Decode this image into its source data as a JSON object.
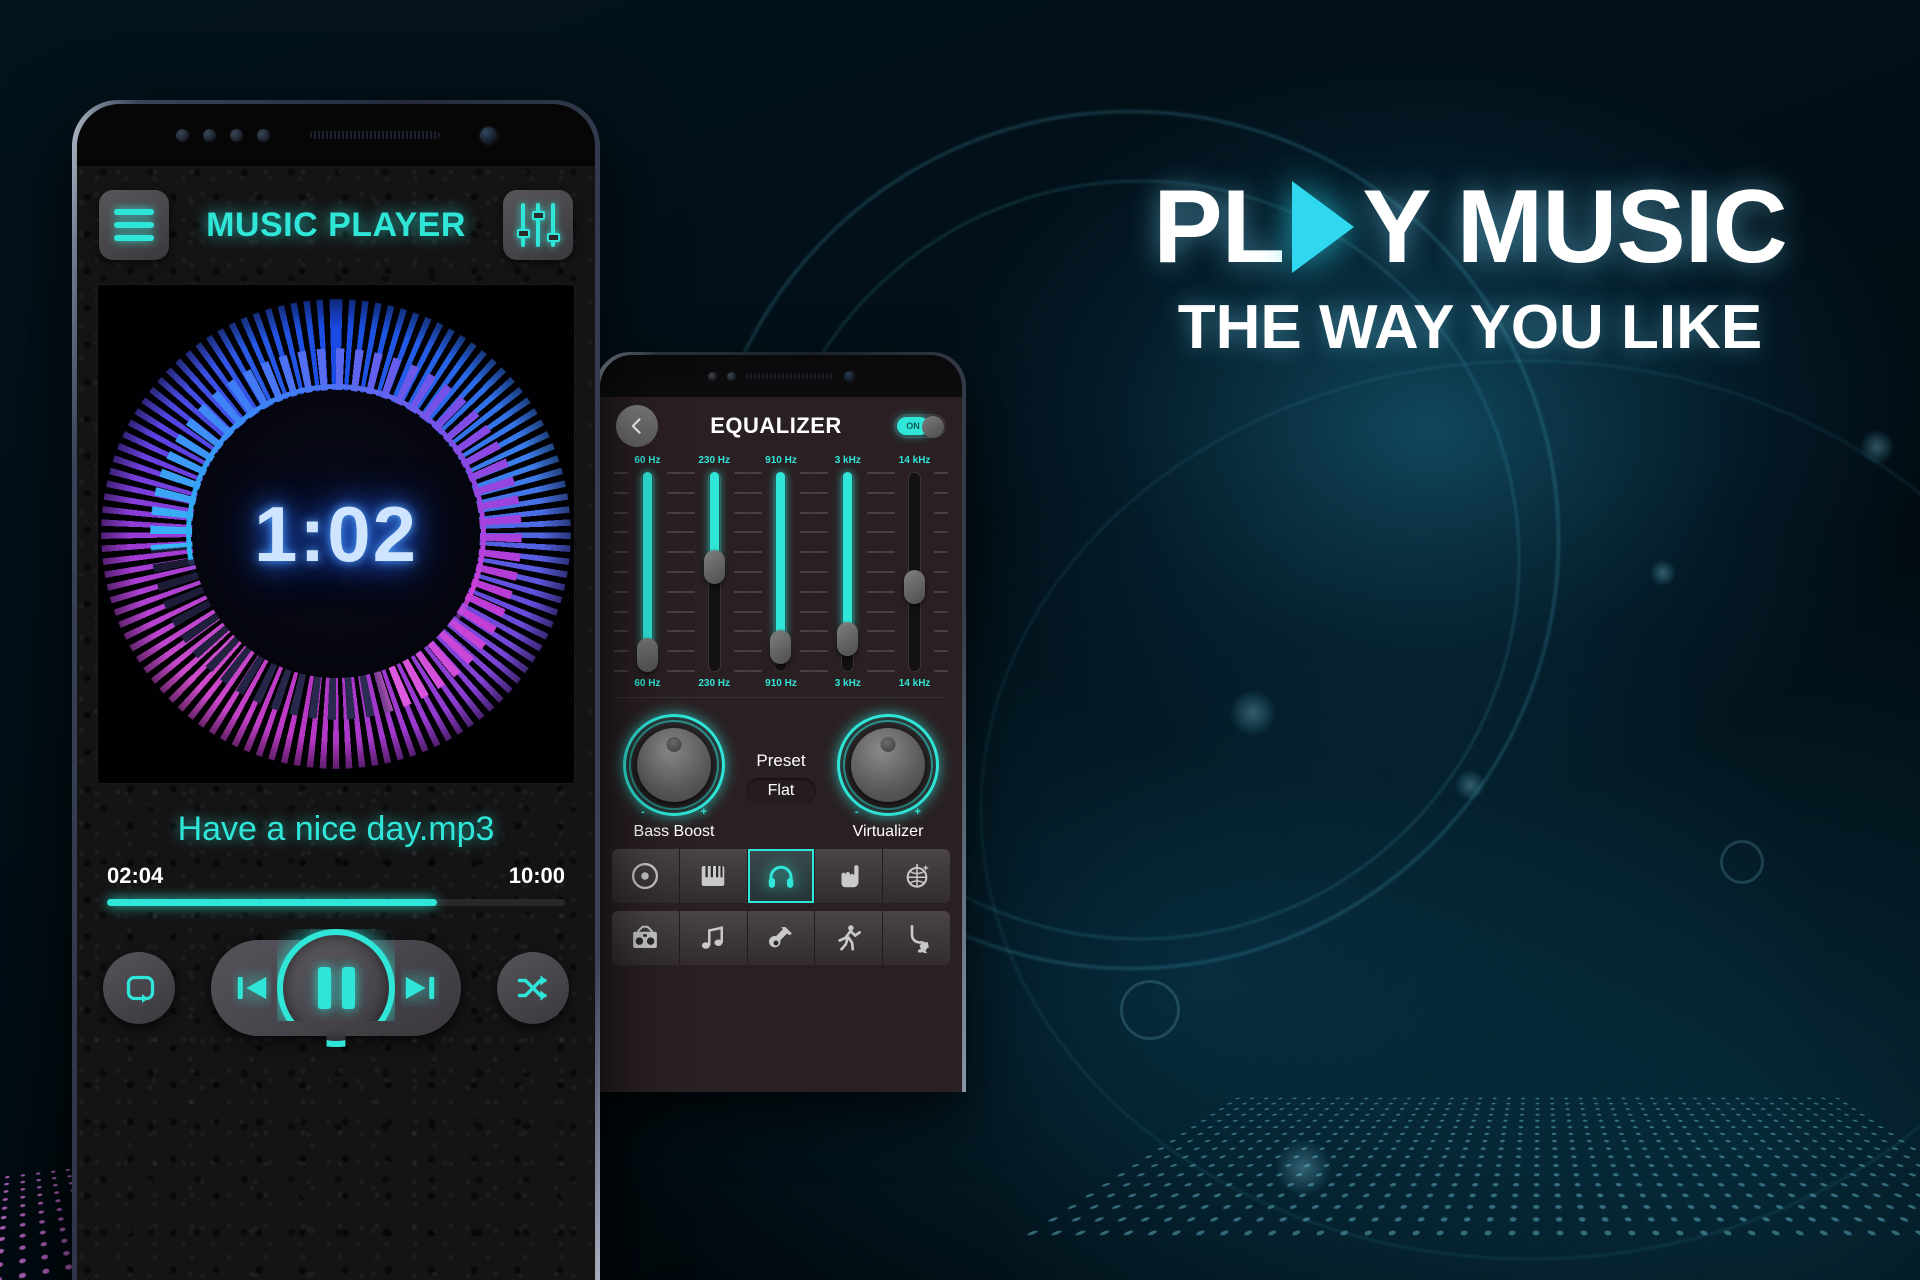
{
  "marketing": {
    "headline_part1": "PL",
    "headline_part2": "Y MUSIC",
    "tagline": "THE WAY YOU LIKE",
    "accent_color": "#2fd8ee"
  },
  "player_phone": {
    "header": {
      "menu_icon": "hamburger-menu-icon",
      "title": "MUSIC PLAYER",
      "equalizer_icon": "equalizer-sliders-icon"
    },
    "album_art": {
      "elapsed_display": "1:02",
      "visualizer": "radial-dot-burst"
    },
    "track_name": "Have a nice day.mp3",
    "time_current": "02:04",
    "time_total": "10:00",
    "progress_percent": 72,
    "controls": {
      "repeat": "repeat-icon",
      "previous": "previous-track-icon",
      "play_pause": "pause-icon",
      "next": "next-track-icon",
      "shuffle": "shuffle-icon"
    }
  },
  "equalizer_phone": {
    "header": {
      "back_icon": "chevron-left-icon",
      "title": "EQUALIZER",
      "toggle_label": "ON",
      "toggle_state": "on"
    },
    "bands": [
      {
        "label": "60 Hz",
        "value": 96,
        "thumb": 4
      },
      {
        "label": "230 Hz",
        "value": 52,
        "thumb": 48
      },
      {
        "label": "910 Hz",
        "value": 92,
        "thumb": 8
      },
      {
        "label": "3 kHz",
        "value": 88,
        "thumb": 12
      },
      {
        "label": "14 kHz",
        "value": 0,
        "thumb": 38
      }
    ],
    "knobs": {
      "bass_boost_label": "Bass Boost",
      "virtualizer_label": "Virtualizer",
      "minus_sign": "-",
      "plus_sign": "+"
    },
    "preset": {
      "title": "Preset",
      "value": "Flat"
    },
    "preset_icons_row1": [
      {
        "name": "disc-icon",
        "active": false
      },
      {
        "name": "piano-icon",
        "active": false
      },
      {
        "name": "headphones-icon",
        "active": true
      },
      {
        "name": "rock-hand-icon",
        "active": false
      },
      {
        "name": "disco-ball-icon",
        "active": false
      }
    ],
    "preset_icons_row2": [
      {
        "name": "boombox-icon",
        "active": false
      },
      {
        "name": "music-note-icon",
        "active": false
      },
      {
        "name": "guitar-icon",
        "active": false
      },
      {
        "name": "dancer-icon",
        "active": false
      },
      {
        "name": "saxophone-icon",
        "active": false
      }
    ]
  }
}
